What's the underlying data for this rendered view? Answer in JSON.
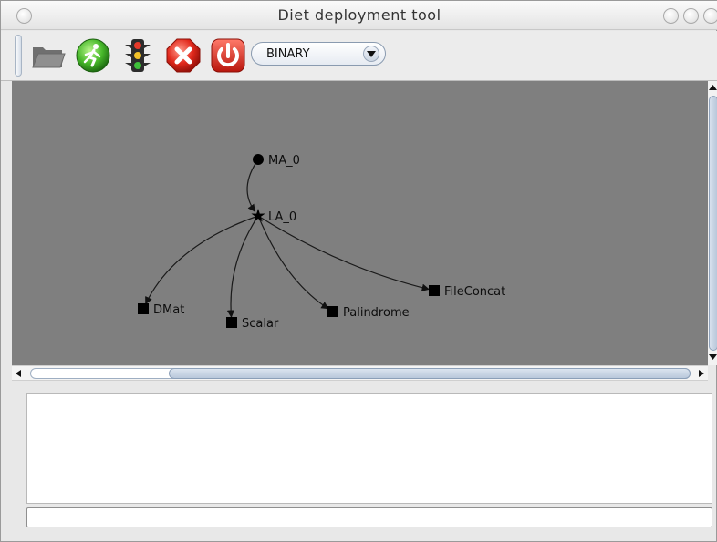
{
  "window": {
    "title": "Diet deployment tool"
  },
  "toolbar": {
    "buttons": [
      {
        "name": "open-folder-icon"
      },
      {
        "name": "run-icon"
      },
      {
        "name": "traffic-light-icon"
      },
      {
        "name": "stop-icon"
      },
      {
        "name": "power-icon"
      }
    ],
    "mode_select": {
      "value": "BINARY"
    }
  },
  "graph": {
    "background": "#7f7f7f",
    "edge_color": "#1a1a1a",
    "nodes": [
      {
        "id": "ma0",
        "label": "MA_0",
        "shape": "circle"
      },
      {
        "id": "la0",
        "label": "LA_0",
        "shape": "star"
      },
      {
        "id": "dmat",
        "label": "DMat",
        "shape": "square"
      },
      {
        "id": "scalar",
        "label": "Scalar",
        "shape": "square"
      },
      {
        "id": "palindrome",
        "label": "Palindrome",
        "shape": "square"
      },
      {
        "id": "fileconcat",
        "label": "FileConcat",
        "shape": "square"
      }
    ],
    "edges": [
      {
        "from": "ma0",
        "to": "la0"
      },
      {
        "from": "la0",
        "to": "dmat"
      },
      {
        "from": "la0",
        "to": "scalar"
      },
      {
        "from": "la0",
        "to": "palindrome"
      },
      {
        "from": "la0",
        "to": "fileconcat"
      }
    ]
  },
  "log": {
    "text": ""
  },
  "command": {
    "value": ""
  }
}
